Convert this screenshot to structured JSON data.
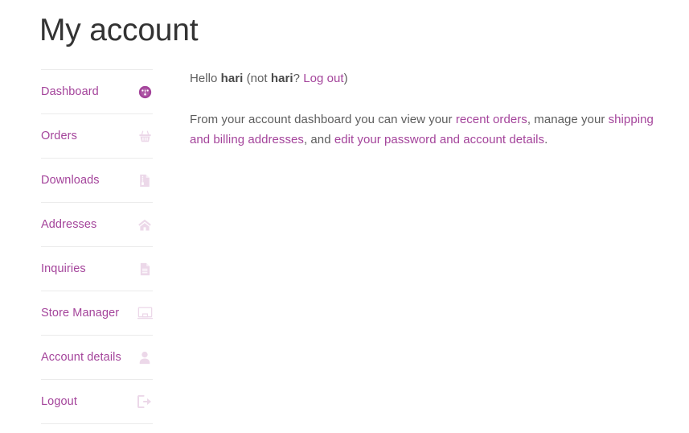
{
  "page": {
    "title": "My account"
  },
  "sidebar": {
    "items": [
      {
        "label": "Dashboard",
        "icon": "dashboard-gauge-icon",
        "active": true
      },
      {
        "label": "Orders",
        "icon": "shopping-basket-icon",
        "active": false
      },
      {
        "label": "Downloads",
        "icon": "download-file-icon",
        "active": false
      },
      {
        "label": "Addresses",
        "icon": "home-icon",
        "active": false
      },
      {
        "label": "Inquiries",
        "icon": "document-icon",
        "active": false
      },
      {
        "label": "Store Manager",
        "icon": "monitor-icon",
        "active": false
      },
      {
        "label": "Account details",
        "icon": "user-icon",
        "active": false
      },
      {
        "label": "Logout",
        "icon": "sign-out-icon",
        "active": false
      }
    ]
  },
  "main": {
    "greeting": {
      "hello_prefix": "Hello ",
      "username": "hari",
      "not_prefix": " (not ",
      "not_username": "hari",
      "question": "? ",
      "logout_link": "Log out",
      "suffix": ")"
    },
    "description": {
      "part1": "From your account dashboard you can view your ",
      "link_recent_orders": "recent orders",
      "part2": ", manage your ",
      "link_addresses": "shipping and billing addresses",
      "part3": ", and ",
      "link_account_details": "edit your password and account details",
      "part4": "."
    }
  },
  "colors": {
    "accent": "#a4449b",
    "icon_muted": "#ecd8e9",
    "body_text": "#5d5d5d",
    "title_text": "#333333",
    "divider": "#ebebeb"
  }
}
